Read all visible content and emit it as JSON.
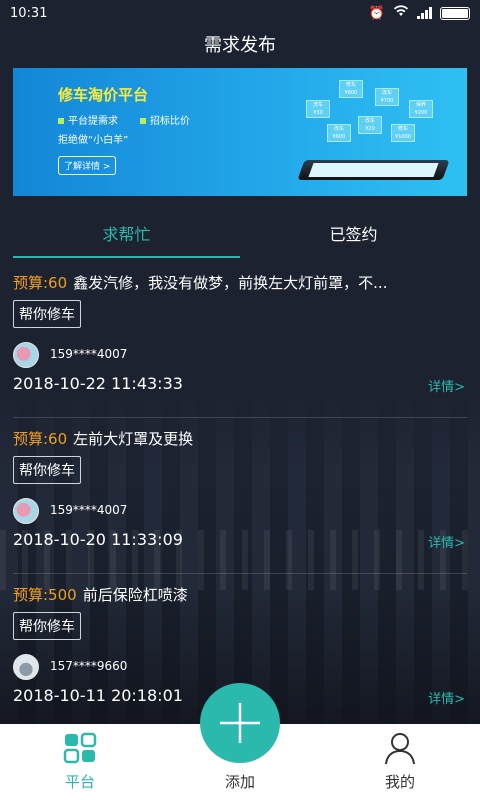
{
  "status_bar": {
    "time": "10:31"
  },
  "title": "需求发布",
  "banner": {
    "title": "修车淘价平台",
    "point1": "平台提需求",
    "point2": "招标比价",
    "slogan": "拒绝做“小白羊”",
    "button": "了解详情 >",
    "tags": [
      "修车\n¥800",
      "洗车\n¥30",
      "改车\n¥700",
      "保养\n¥200",
      "改车\n¥20",
      "修车\n¥1000",
      "改车\n¥600"
    ]
  },
  "tabs": [
    {
      "label": "求帮忙"
    },
    {
      "label": "已签约"
    }
  ],
  "requests": [
    {
      "budget": "预算:60",
      "title": "鑫发汽修，我没有做梦，前换左大灯前罩，不...",
      "help": "帮你修车",
      "phone": "159****4007",
      "datetime": "2018-10-22 11:43:33",
      "detail": "详情>"
    },
    {
      "budget": "预算:60",
      "title": "左前大灯罩及更换",
      "help": "帮你修车",
      "phone": "159****4007",
      "datetime": "2018-10-20 11:33:09",
      "detail": "详情>"
    },
    {
      "budget": "预算:500",
      "title": "前后保险杠喷漆",
      "help": "帮你修车",
      "phone": "157****9660",
      "datetime": "2018-10-11 20:18:01",
      "detail": "详情>"
    }
  ],
  "nav": {
    "platform": "平台",
    "add": "添加",
    "mine": "我的"
  },
  "colors": {
    "accent": "#2bb8ad",
    "budget": "#f0a020"
  }
}
